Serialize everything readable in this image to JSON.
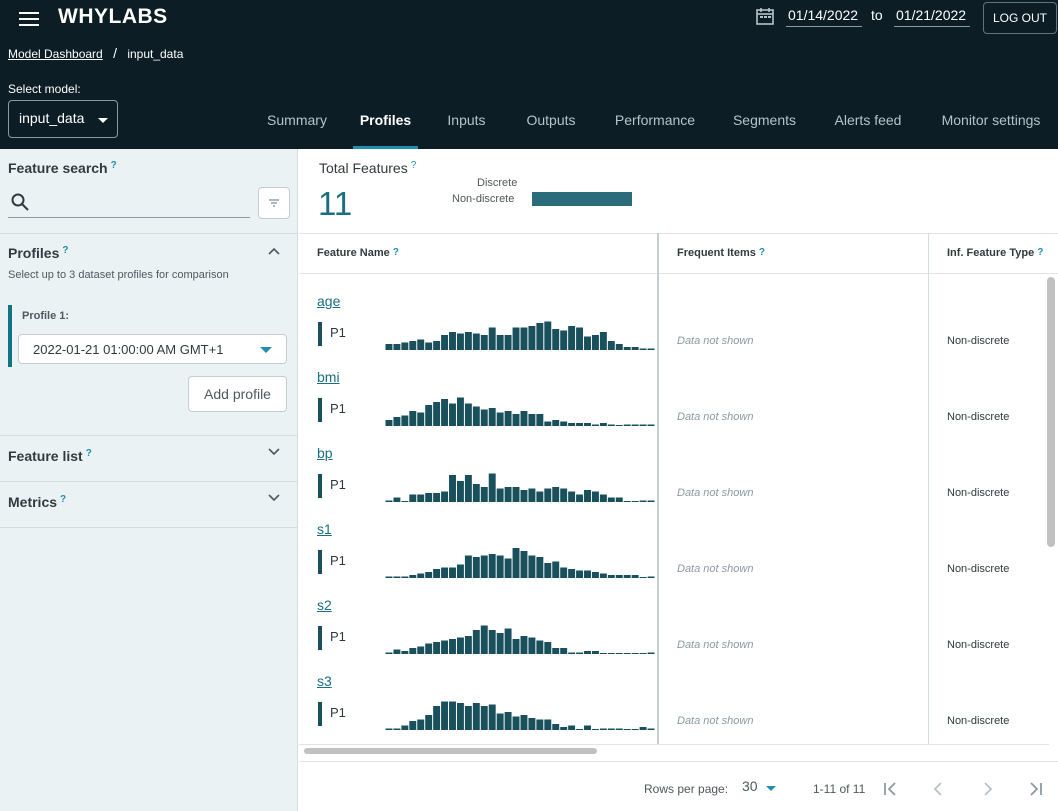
{
  "header": {
    "logo": "WHYLABS",
    "date_from": "01/14/2022",
    "date_to_label": "to",
    "date_to": "01/21/2022",
    "logout_label": "LOG OUT"
  },
  "breadcrumb": {
    "root": "Model Dashboard",
    "separator": "/",
    "current": "input_data"
  },
  "model_select": {
    "label": "Select model:",
    "value": "input_data"
  },
  "tabs": [
    {
      "label": "Summary"
    },
    {
      "label": "Profiles",
      "active": true
    },
    {
      "label": "Inputs"
    },
    {
      "label": "Outputs"
    },
    {
      "label": "Performance"
    },
    {
      "label": "Segments"
    },
    {
      "label": "Alerts feed"
    },
    {
      "label": "Monitor settings"
    }
  ],
  "sidebar": {
    "feature_search": {
      "title": "Feature search",
      "help": "?",
      "placeholder": ""
    },
    "profiles": {
      "title": "Profiles",
      "help": "?",
      "subtitle": "Select up to 3 dataset profiles for comparison",
      "profile_label": "Profile 1:",
      "profile_value": "2022-01-21 01:00:00 AM GMT+1",
      "add_profile": "Add profile"
    },
    "feature_list": {
      "title": "Feature list",
      "help": "?"
    },
    "metrics": {
      "title": "Metrics",
      "help": "?"
    }
  },
  "summary": {
    "total_label": "Total Features",
    "help": "?",
    "total_value": "11",
    "legend_discrete": "Discrete",
    "legend_non_discrete": "Non-discrete",
    "discrete_count": 0,
    "non_discrete_count": 11
  },
  "table": {
    "headers": {
      "feature_name": "Feature Name",
      "frequent_items": "Frequent Items",
      "inf_feature_type": "Inf. Feature Type",
      "help": "?"
    },
    "profile_tag": "P1",
    "rows": [
      {
        "name": "age",
        "frequent": "Data not shown",
        "type": "Non-discrete",
        "hist": [
          0.2,
          0.2,
          0.25,
          0.3,
          0.35,
          0.25,
          0.3,
          0.5,
          0.6,
          0.55,
          0.6,
          0.55,
          0.5,
          0.75,
          0.5,
          0.5,
          0.75,
          0.75,
          0.8,
          0.9,
          0.95,
          0.7,
          0.65,
          0.8,
          0.75,
          0.45,
          0.5,
          0.6,
          0.3,
          0.2,
          0.1,
          0.1,
          0.05,
          0.05
        ]
      },
      {
        "name": "bmi",
        "frequent": "Data not shown",
        "type": "Non-discrete",
        "hist": [
          0.2,
          0.3,
          0.35,
          0.5,
          0.45,
          0.7,
          0.8,
          0.9,
          0.75,
          0.95,
          0.75,
          0.65,
          0.55,
          0.6,
          0.45,
          0.5,
          0.4,
          0.5,
          0.4,
          0.4,
          0.15,
          0.2,
          0.15,
          0.1,
          0.1,
          0.1,
          0.05,
          0.1,
          0.05,
          0,
          0.05,
          0.05,
          0.05,
          0.05
        ]
      },
      {
        "name": "bp",
        "frequent": "Data not shown",
        "type": "Non-discrete",
        "hist": [
          0.05,
          0.15,
          0,
          0.25,
          0.25,
          0.3,
          0.3,
          0.35,
          0.9,
          0.7,
          0.9,
          0.6,
          0.5,
          0.95,
          0.45,
          0.5,
          0.5,
          0.4,
          0.45,
          0.35,
          0.45,
          0.5,
          0.45,
          0.35,
          0.25,
          0.4,
          0.35,
          0.25,
          0.15,
          0.15,
          0,
          0,
          0.05,
          0.05
        ]
      },
      {
        "name": "s1",
        "frequent": "Data not shown",
        "type": "Non-discrete",
        "hist": [
          0.05,
          0.05,
          0.05,
          0.1,
          0.15,
          0.2,
          0.3,
          0.35,
          0.35,
          0.45,
          0.75,
          0.7,
          0.75,
          0.8,
          0.75,
          0.65,
          1.0,
          0.9,
          0.75,
          0.7,
          0.5,
          0.55,
          0.35,
          0.3,
          0.25,
          0.25,
          0.2,
          0.15,
          0.1,
          0.1,
          0.1,
          0.1,
          0,
          0.05
        ]
      },
      {
        "name": "s2",
        "frequent": "Data not shown",
        "type": "Non-discrete",
        "hist": [
          0.05,
          0.15,
          0.1,
          0.2,
          0.25,
          0.35,
          0.4,
          0.45,
          0.5,
          0.55,
          0.6,
          0.8,
          0.95,
          0.8,
          0.7,
          0.85,
          0.5,
          0.6,
          0.55,
          0.45,
          0.4,
          0.2,
          0.2,
          0.05,
          0.05,
          0.1,
          0.1,
          0,
          0,
          0,
          0,
          0,
          0,
          0.05
        ]
      },
      {
        "name": "s3",
        "frequent": "Data not shown",
        "type": "Non-discrete",
        "hist": [
          0.05,
          0.05,
          0.15,
          0.3,
          0.35,
          0.5,
          0.8,
          0.95,
          0.95,
          0.9,
          0.8,
          0.9,
          0.8,
          0.85,
          0.55,
          0.6,
          0.45,
          0.5,
          0.4,
          0.35,
          0.35,
          0.2,
          0.1,
          0.15,
          0,
          0.15,
          0,
          0.05,
          0.05,
          0.05,
          0,
          0,
          0.1,
          0.05
        ]
      }
    ]
  },
  "pagination": {
    "rows_per_page_label": "Rows per page:",
    "rows_per_page": "30",
    "range": "1-11 of 11"
  },
  "colors": {
    "header_bg": "#0c1d26",
    "accent": "#1e8fae",
    "bar": "#1a4f5c",
    "sidebar_bg": "#ebf2f3"
  }
}
